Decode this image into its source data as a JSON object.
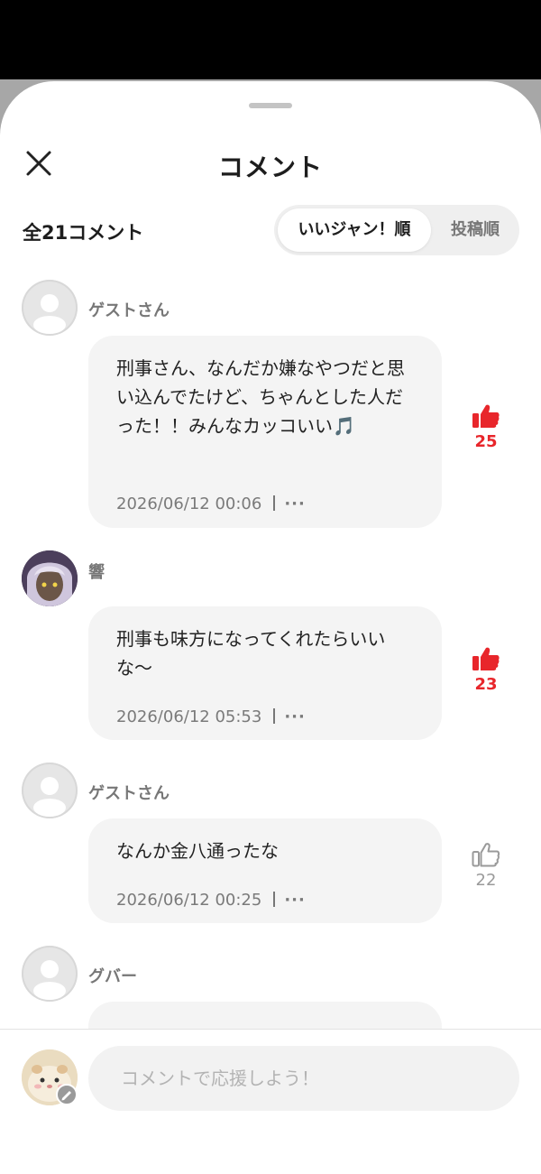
{
  "header": {
    "title": "コメント",
    "total_label": "全21コメント",
    "sort_options": [
      "いいジャン！順",
      "投稿順"
    ]
  },
  "comments": [
    {
      "user": "ゲストさん",
      "text": "刑事さん、なんだか嫌なやつだと思い込んでたけど、ちゃんとした人だった！！みんなカッコいい🎵",
      "date": "2026/06/12 00:06",
      "likes": "25",
      "liked": true
    },
    {
      "user": "響",
      "text": "刑事も味方になってくれたらいいな〜",
      "date": "2026/06/12 05:53",
      "likes": "23",
      "liked": true
    },
    {
      "user": "ゲストさん",
      "text": "なんか金八通ったな",
      "date": "2026/06/12 00:25",
      "likes": "22",
      "liked": false
    },
    {
      "user": "グバー",
      "text": "",
      "date": "",
      "likes": "",
      "liked": false
    }
  ],
  "footer": {
    "placeholder": "コメントで応援しよう！"
  },
  "colors": {
    "liked": "#e8262b",
    "unliked": "#9a9a9a",
    "bubble": "#f4f4f4"
  },
  "icons": [
    "close-icon",
    "thumbs-up-icon",
    "more-dots-icon",
    "edit-pencil-icon",
    "guest-avatar-icon"
  ]
}
